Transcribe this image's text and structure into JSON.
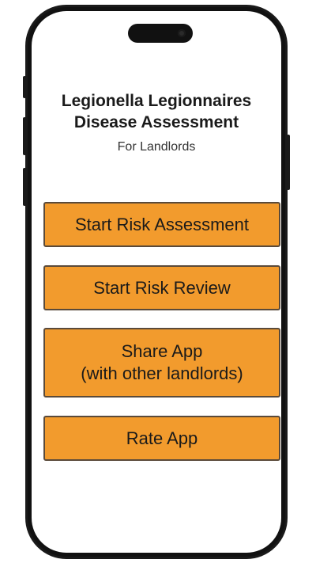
{
  "app": {
    "title_line1": "Legionella Legionnaires",
    "title_line2": "Disease Assessment",
    "subtitle": "For Landlords"
  },
  "buttons": {
    "start_risk_assessment": "Start Risk Assessment",
    "start_risk_review": "Start Risk Review",
    "share_app_line1": "Share App",
    "share_app_line2": "(with other landlords)",
    "rate_app": "Rate App"
  },
  "colors": {
    "button_fill": "#f29b2d",
    "button_border": "#5a4a3a",
    "phone_frame": "#111111"
  }
}
